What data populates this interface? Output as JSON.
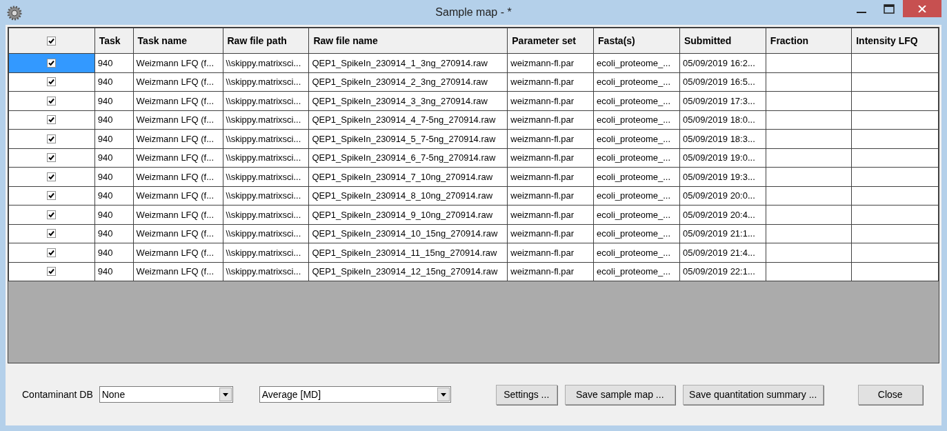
{
  "window": {
    "title": "Sample map - *"
  },
  "table": {
    "header_checked": true,
    "columns": [
      "Task",
      "Task name",
      "Raw file path",
      "Raw file name",
      "Parameter set",
      "Fasta(s)",
      "Submitted",
      "Fraction",
      "Intensity LFQ"
    ],
    "rows": [
      {
        "checked": true,
        "selected": true,
        "cells": [
          "940",
          "Weizmann LFQ (f...",
          "\\\\skippy.matrixsci...",
          "QEP1_SpikeIn_230914_1_3ng_270914.raw",
          "weizmann-fl.par",
          "ecoli_proteome_...",
          "05/09/2019 16:2..."
        ]
      },
      {
        "checked": true,
        "selected": false,
        "cells": [
          "940",
          "Weizmann LFQ (f...",
          "\\\\skippy.matrixsci...",
          "QEP1_SpikeIn_230914_2_3ng_270914.raw",
          "weizmann-fl.par",
          "ecoli_proteome_...",
          "05/09/2019 16:5..."
        ]
      },
      {
        "checked": true,
        "selected": false,
        "cells": [
          "940",
          "Weizmann LFQ (f...",
          "\\\\skippy.matrixsci...",
          "QEP1_SpikeIn_230914_3_3ng_270914.raw",
          "weizmann-fl.par",
          "ecoli_proteome_...",
          "05/09/2019 17:3..."
        ]
      },
      {
        "checked": true,
        "selected": false,
        "cells": [
          "940",
          "Weizmann LFQ (f...",
          "\\\\skippy.matrixsci...",
          "QEP1_SpikeIn_230914_4_7-5ng_270914.raw",
          "weizmann-fl.par",
          "ecoli_proteome_...",
          "05/09/2019 18:0..."
        ]
      },
      {
        "checked": true,
        "selected": false,
        "cells": [
          "940",
          "Weizmann LFQ (f...",
          "\\\\skippy.matrixsci...",
          "QEP1_SpikeIn_230914_5_7-5ng_270914.raw",
          "weizmann-fl.par",
          "ecoli_proteome_...",
          "05/09/2019 18:3..."
        ]
      },
      {
        "checked": true,
        "selected": false,
        "cells": [
          "940",
          "Weizmann LFQ (f...",
          "\\\\skippy.matrixsci...",
          "QEP1_SpikeIn_230914_6_7-5ng_270914.raw",
          "weizmann-fl.par",
          "ecoli_proteome_...",
          "05/09/2019 19:0..."
        ]
      },
      {
        "checked": true,
        "selected": false,
        "cells": [
          "940",
          "Weizmann LFQ (f...",
          "\\\\skippy.matrixsci...",
          "QEP1_SpikeIn_230914_7_10ng_270914.raw",
          "weizmann-fl.par",
          "ecoli_proteome_...",
          "05/09/2019 19:3..."
        ]
      },
      {
        "checked": true,
        "selected": false,
        "cells": [
          "940",
          "Weizmann LFQ (f...",
          "\\\\skippy.matrixsci...",
          "QEP1_SpikeIn_230914_8_10ng_270914.raw",
          "weizmann-fl.par",
          "ecoli_proteome_...",
          "05/09/2019 20:0..."
        ]
      },
      {
        "checked": true,
        "selected": false,
        "cells": [
          "940",
          "Weizmann LFQ (f...",
          "\\\\skippy.matrixsci...",
          "QEP1_SpikeIn_230914_9_10ng_270914.raw",
          "weizmann-fl.par",
          "ecoli_proteome_...",
          "05/09/2019 20:4..."
        ]
      },
      {
        "checked": true,
        "selected": false,
        "cells": [
          "940",
          "Weizmann LFQ (f...",
          "\\\\skippy.matrixsci...",
          "QEP1_SpikeIn_230914_10_15ng_270914.raw",
          "weizmann-fl.par",
          "ecoli_proteome_...",
          "05/09/2019 21:1..."
        ]
      },
      {
        "checked": true,
        "selected": false,
        "cells": [
          "940",
          "Weizmann LFQ (f...",
          "\\\\skippy.matrixsci...",
          "QEP1_SpikeIn_230914_11_15ng_270914.raw",
          "weizmann-fl.par",
          "ecoli_proteome_...",
          "05/09/2019 21:4..."
        ]
      },
      {
        "checked": true,
        "selected": false,
        "cells": [
          "940",
          "Weizmann LFQ (f...",
          "\\\\skippy.matrixsci...",
          "QEP1_SpikeIn_230914_12_15ng_270914.raw",
          "weizmann-fl.par",
          "ecoli_proteome_...",
          "05/09/2019 22:1..."
        ]
      }
    ]
  },
  "controls": {
    "contaminant_label": "Contaminant DB",
    "contaminant_value": "None",
    "average_value": "Average [MD]"
  },
  "buttons": [
    "Settings ...",
    "Save sample map ...",
    "Save quantitation summary ...",
    "Close"
  ]
}
